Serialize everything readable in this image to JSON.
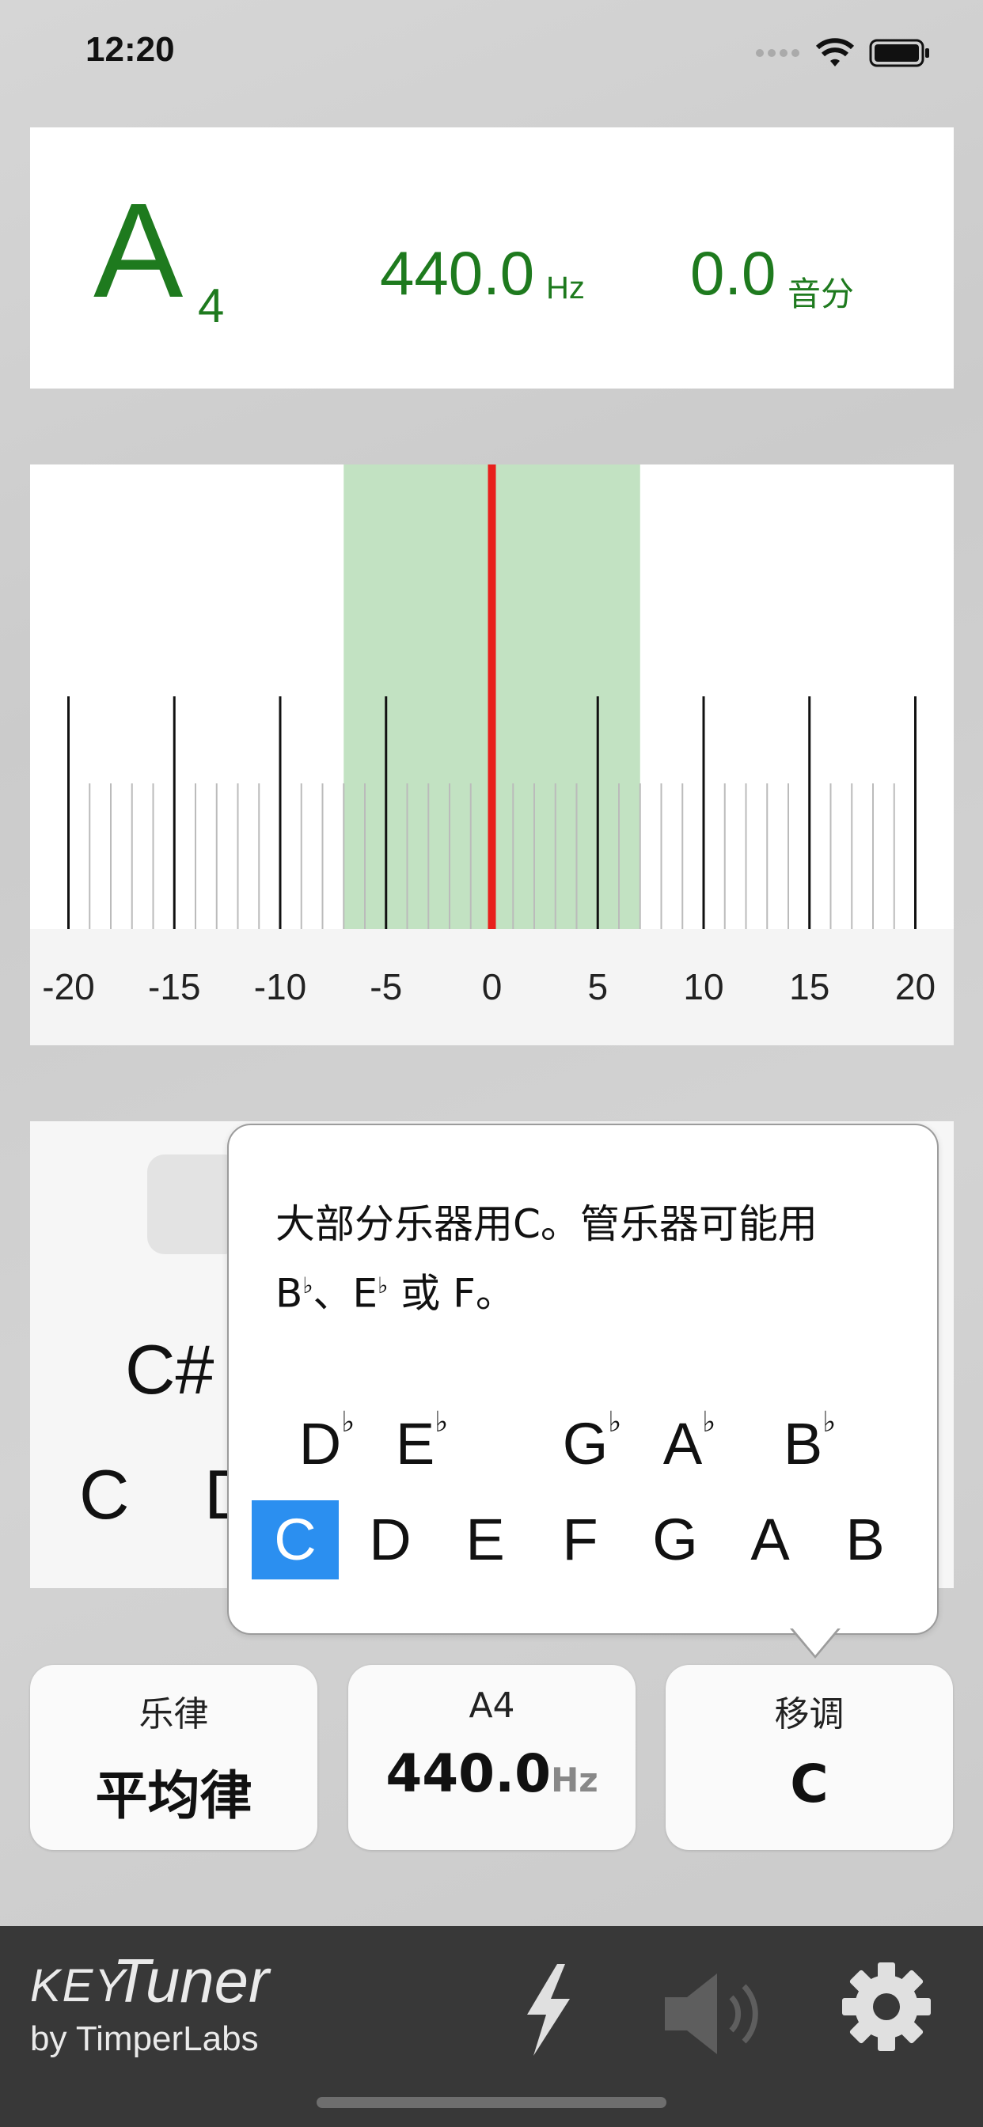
{
  "status_bar": {
    "time": "12:20"
  },
  "reading": {
    "note": "A",
    "octave": "4",
    "frequency": "440.0",
    "frequency_unit": "Hz",
    "cents": "0.0",
    "cents_unit": "音分"
  },
  "meter": {
    "tick_labels": [
      "-20",
      "-15",
      "-10",
      "-5",
      "0",
      "5",
      "10",
      "15",
      "20"
    ],
    "in_tune_range_cents": [
      -7,
      7
    ],
    "needle_cents": 0,
    "colors": {
      "needle": "#e8201c",
      "in_tune": "#c2e2c2"
    }
  },
  "key_card": {
    "visible_keys": [
      "C#",
      "C",
      "D"
    ]
  },
  "popover": {
    "line1": "大部分乐器用C。管乐器可能用",
    "line2_parts": [
      "B",
      "♭",
      "、E",
      "♭",
      " 或 F。"
    ],
    "flat_keys": [
      "D",
      "E",
      "G",
      "A",
      "B"
    ],
    "flat_symbol": "♭",
    "natural_keys": [
      "C",
      "D",
      "E",
      "F",
      "G",
      "A",
      "B"
    ],
    "selected_key": "C",
    "accent_color": "#2b8ff0"
  },
  "settings": {
    "temperament": {
      "label": "乐律",
      "value": "平均律"
    },
    "a4": {
      "label": "A4",
      "value": "440.0",
      "unit": "Hz"
    },
    "transpose": {
      "label": "移调",
      "value": "C"
    }
  },
  "bottom_bar": {
    "logo_key": "KEY",
    "logo_tuner": "Tuner",
    "logo_by": "by TimperLabs",
    "icons": [
      "lightning-icon",
      "speaker-icon",
      "gear-icon"
    ]
  }
}
